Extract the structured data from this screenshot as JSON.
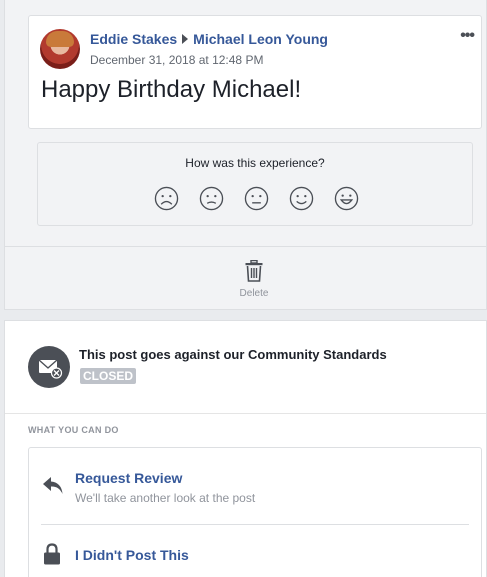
{
  "post": {
    "author": "Eddie Stakes",
    "recipient": "Michael Leon Young",
    "date": "December 31, 2018 at 12:48 PM",
    "text": "Happy Birthday Michael!",
    "more_icon": "ellipsis-icon",
    "more_label": "•••"
  },
  "feedback": {
    "question": "How was this experience?",
    "faces": [
      "very-sad-face-icon",
      "sad-face-icon",
      "neutral-face-icon",
      "happy-face-icon",
      "very-happy-face-icon"
    ]
  },
  "delete": {
    "label": "Delete",
    "icon": "trash-icon"
  },
  "status": {
    "title": "This post goes against our Community Standards",
    "badge": "CLOSED",
    "icon": "hidden-message-icon"
  },
  "options": {
    "heading": "WHAT YOU CAN DO",
    "items": [
      {
        "title": "Request Review",
        "subtitle": "We'll take another look at the post",
        "icon": "reply-arrow-icon"
      },
      {
        "title": "I Didn't Post This",
        "icon": "lock-icon"
      }
    ]
  },
  "colors": {
    "link": "#365899",
    "badge_bg": "#bec2c9",
    "icon_dark": "#4b4f56"
  }
}
